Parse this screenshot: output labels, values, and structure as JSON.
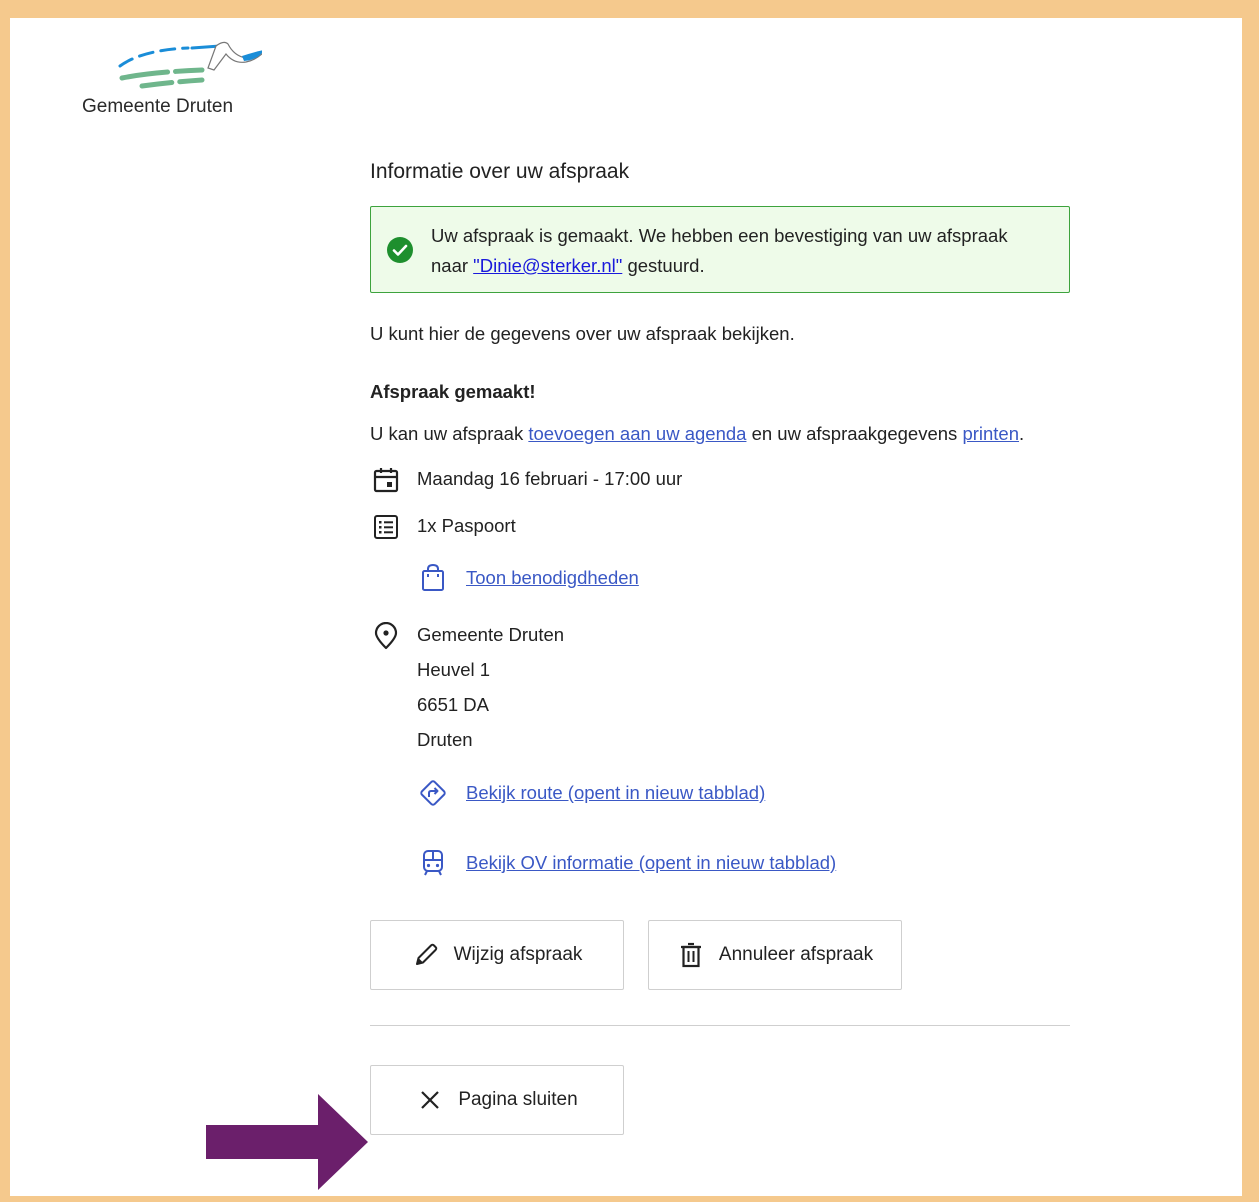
{
  "logo": {
    "text": "Gemeente Druten"
  },
  "page_title": "Informatie over uw afspraak",
  "alert": {
    "text_before": "Uw afspraak is gemaakt. We hebben een bevestiging van uw afspraak naar ",
    "email_link": "\"Dinie@sterker.nl\"",
    "text_after": " gestuurd."
  },
  "intro": "U kunt hier de gegevens over uw afspraak bekijken.",
  "heading": "Afspraak gemaakt!",
  "agenda_para": {
    "text1": "U kan uw afspraak ",
    "link1": "toevoegen aan uw agenda",
    "text2": " en uw afspraakgegevens ",
    "link2": "printen",
    "text3": "."
  },
  "appointment": {
    "datetime": "Maandag 16 februari - 17:00 uur",
    "product": "1x Paspoort",
    "requirements_link": "Toon benodigdheden",
    "location": {
      "name": "Gemeente Druten",
      "street": "Heuvel 1",
      "postcode": "6651 DA",
      "city": "Druten"
    },
    "route_link": "Bekijk route (opent in nieuw tabblad)",
    "ov_link": "Bekijk OV informatie (opent in nieuw tabblad)"
  },
  "buttons": {
    "change": "Wijzig afspraak",
    "cancel": "Annuleer afspraak",
    "close": "Pagina sluiten"
  },
  "colors": {
    "page_border": "#f5c98d",
    "success_border": "#3da33d",
    "success_bg": "#eefbe9",
    "link": "#3a58c5",
    "arrow": "#6b1f6b"
  },
  "icons": {
    "success": "check-circle-icon",
    "date": "calendar-icon",
    "product": "list-icon",
    "requirements": "shopping-bag-icon",
    "location": "map-pin-icon",
    "route": "route-icon",
    "ov": "train-icon",
    "change": "pencil-icon",
    "cancel": "trash-icon",
    "close": "close-icon"
  }
}
